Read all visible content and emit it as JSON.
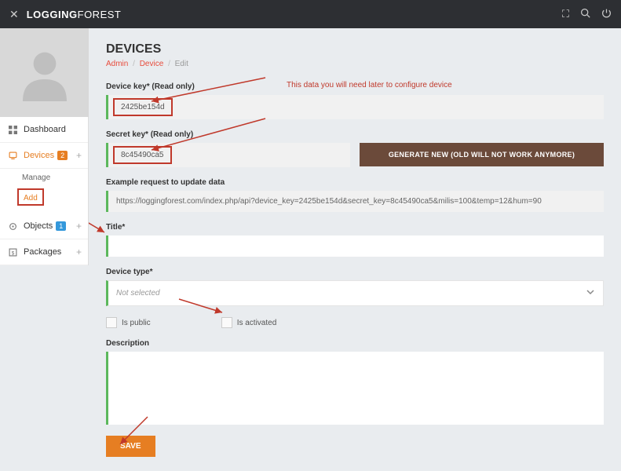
{
  "brand": {
    "bold": "LOGGING",
    "light": "FOREST"
  },
  "sidebar": {
    "dashboard": "Dashboard",
    "devices": "Devices",
    "devices_badge": "2",
    "manage": "Manage",
    "add": "Add",
    "objects": "Objects",
    "objects_badge": "1",
    "packages": "Packages"
  },
  "page": {
    "title": "DEVICES",
    "bc_admin": "Admin",
    "bc_device": "Device",
    "bc_edit": "Edit"
  },
  "fields": {
    "device_key_label": "Device key* (Read only)",
    "device_key_value": "2425be154d",
    "hint": "This data you will need later to configure device",
    "secret_key_label": "Secret key* (Read only)",
    "secret_key_value": "8c45490ca5",
    "generate_btn": "GENERATE NEW (OLD WILL NOT WORK ANYMORE)",
    "example_label": "Example request to update data",
    "example_value": "https://loggingforest.com/index.php/api?device_key=2425be154d&secret_key=8c45490ca5&milis=100&temp=12&hum=90",
    "title_label": "Title*",
    "device_type_label": "Device type*",
    "device_type_placeholder": "Not selected",
    "is_public": "Is public",
    "is_activated": "Is activated",
    "description_label": "Description",
    "save_btn": "SAVE"
  }
}
